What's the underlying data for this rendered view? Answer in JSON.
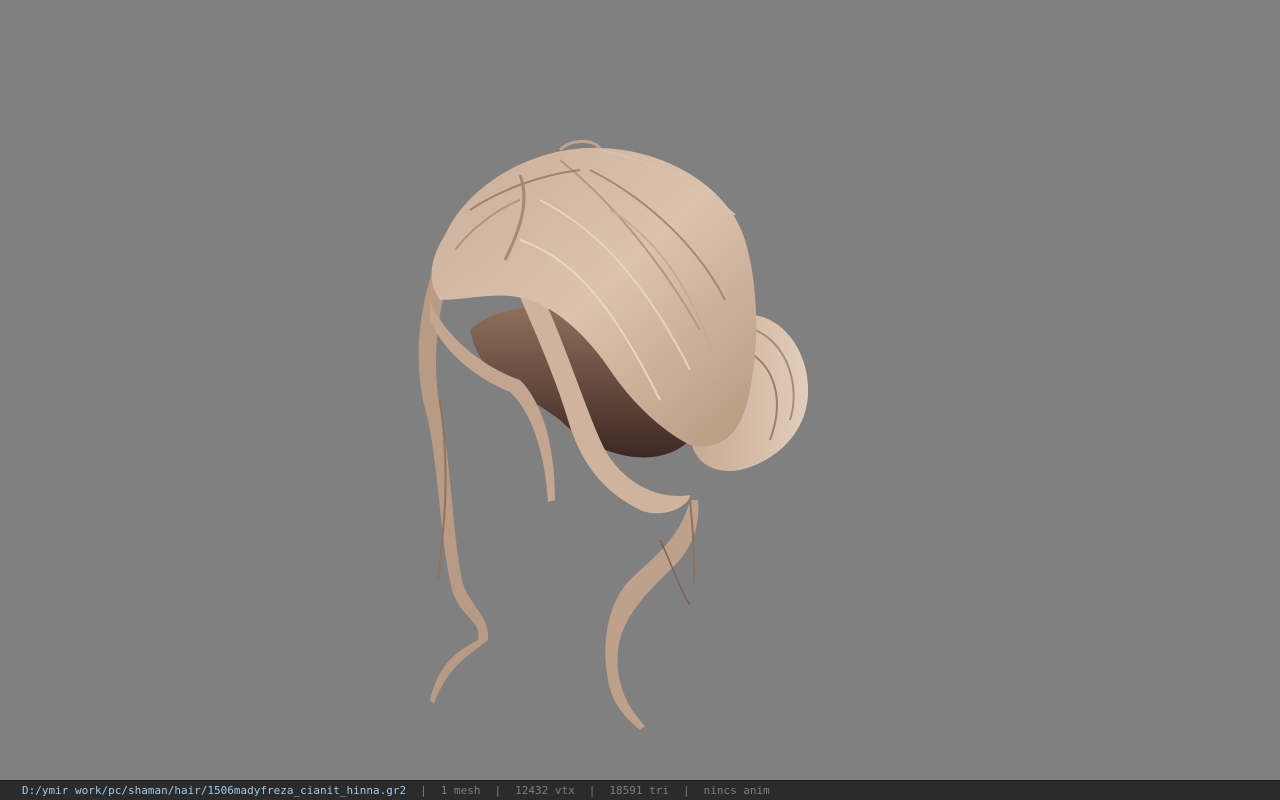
{
  "viewport": {
    "background": "#808080",
    "model_name": "hair mesh"
  },
  "statusbar": {
    "file_path": "D:/ymir work/pc/shaman/hair/1506madyfreza_cianit_hinna.gr2",
    "separator": "|",
    "mesh_count": "1 mesh",
    "vertex_count": "12432 vtx",
    "triangle_count": "18591 tri",
    "anim_status": "nincs anim"
  }
}
